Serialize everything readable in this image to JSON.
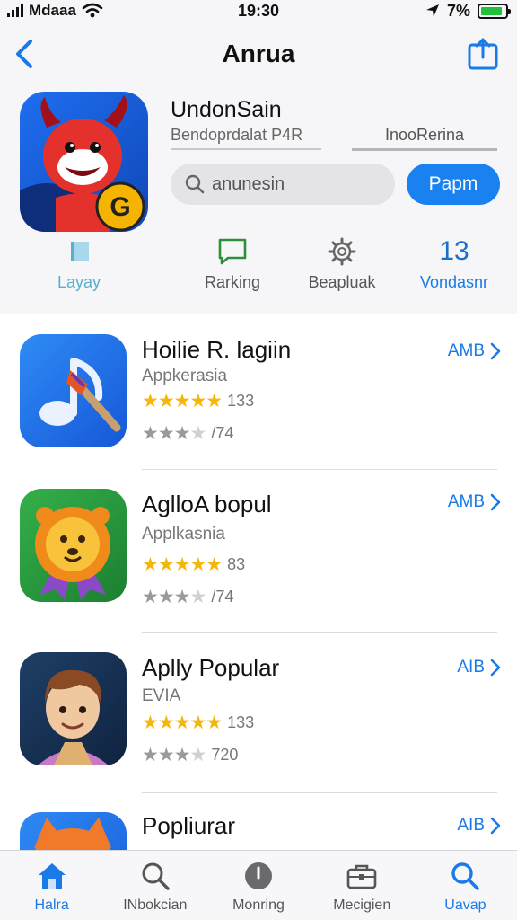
{
  "status_bar": {
    "carrier": "Mdaaa",
    "time": "19:30",
    "battery": "7%",
    "battery_level": 0.9
  },
  "header": {
    "title": "Anrua"
  },
  "featured": {
    "name": "UndonSain",
    "subtitle": "Bendoprdalat P4R",
    "secondary": "InooRerina",
    "search_placeholder": "anunesin",
    "get_label": "Papm"
  },
  "stats": [
    {
      "label": "Layay",
      "icon": "flag-icon"
    },
    {
      "label": "Rarking",
      "icon": "chat-icon"
    },
    {
      "label": "Beapluak",
      "icon": "gear-icon"
    },
    {
      "value": "13",
      "label": "Vondasnr"
    }
  ],
  "apps": [
    {
      "name": "Hoilie R. lagiin",
      "category": "Appkerasia",
      "rating_count": "133",
      "secondary_rating": "/74",
      "rating": 5,
      "secondary_stars": 3.5,
      "action": "AMB"
    },
    {
      "name": "AglloA bopul",
      "category": "Applkasnia",
      "rating_count": "83",
      "secondary_rating": "/74",
      "rating": 5,
      "secondary_stars": 3.5,
      "action": "AMB"
    },
    {
      "name": "Aplly Popular",
      "category": "EVIA",
      "rating_count": "133",
      "secondary_rating": "720",
      "rating": 5,
      "secondary_stars": 3.5,
      "action": "AIB"
    },
    {
      "name": "Popliurar",
      "category": "",
      "rating_count": "",
      "secondary_rating": "",
      "rating": 0,
      "secondary_stars": 0,
      "action": "AIB"
    }
  ],
  "tabs": [
    {
      "label": "Halra",
      "icon": "home-icon",
      "active": true
    },
    {
      "label": "INbokcian",
      "icon": "search-icon",
      "active": false
    },
    {
      "label": "Monring",
      "icon": "clock-icon",
      "active": false
    },
    {
      "label": "Mecigien",
      "icon": "briefcase-icon",
      "active": false
    },
    {
      "label": "Uavap",
      "icon": "search-icon",
      "active": true
    }
  ],
  "colors": {
    "accent": "#1a82f0",
    "star": "#f4b60b",
    "background": "#f6f6f8"
  }
}
